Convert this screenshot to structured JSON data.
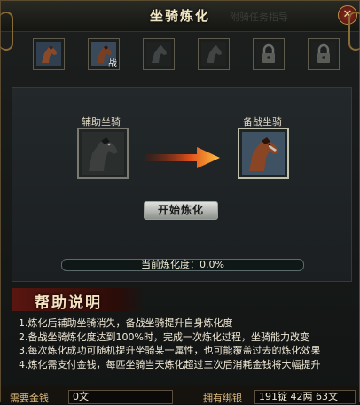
{
  "window": {
    "title": "坐骑炼化",
    "watermark": "附骑任务指导"
  },
  "mount_slots": [
    {
      "name": "mount-1",
      "state": "available",
      "tag": ""
    },
    {
      "name": "mount-2",
      "state": "battle",
      "tag": "战"
    },
    {
      "name": "mount-3",
      "state": "dim",
      "tag": ""
    },
    {
      "name": "mount-4",
      "state": "dim",
      "tag": ""
    },
    {
      "name": "slot-5",
      "state": "locked",
      "tag": ""
    },
    {
      "name": "slot-6",
      "state": "locked",
      "tag": ""
    }
  ],
  "refine": {
    "assist_label": "辅助坐骑",
    "battle_label": "备战坐骑",
    "start_button": "开始炼化",
    "progress_text": "当前炼化度：0.0%",
    "progress_fraction": 0.0
  },
  "help": {
    "title": "帮助说明",
    "lines": [
      "1.炼化后辅助坐骑消失，备战坐骑提升自身炼化度",
      "2.备战坐骑炼化度达到100%时，完成一次炼化过程，坐骑能力改变",
      "3.每次炼化成功可随机提升坐骑某一属性，也可能覆盖过去的炼化效果",
      "4.炼化需支付金钱，每匹坐骑当天炼化超过三次后消耗金钱将大幅提升"
    ]
  },
  "footer": {
    "cost_label": "需要金钱",
    "cost_value": "0文",
    "owned_label": "拥有绑银",
    "owned_value": "191锭 42两 63文"
  },
  "colors": {
    "accent_gold": "#c9a25a",
    "help_banner": "#5a1610",
    "arrow": "#ff9a00"
  }
}
